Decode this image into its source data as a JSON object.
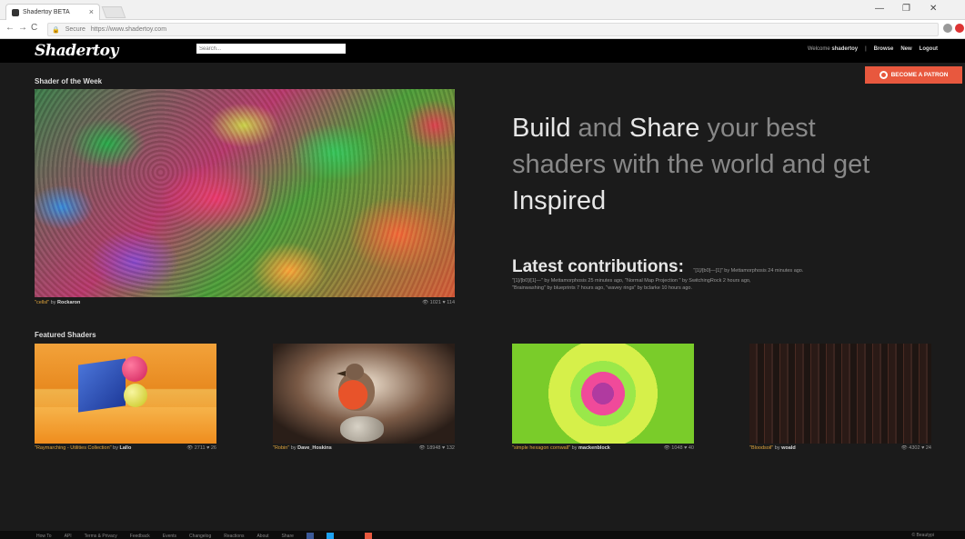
{
  "browser": {
    "tab_title": "Shadertoy BETA",
    "tab_close": "×",
    "secure_label": "Secure",
    "url": "https://www.shadertoy.com",
    "window_controls": [
      "—",
      "❐",
      "✕"
    ],
    "nav": [
      "←",
      "→",
      "C"
    ]
  },
  "header": {
    "logo": "Shadertoy",
    "search_placeholder": "Search...",
    "welcome_label": "Welcome",
    "username": "shadertoy",
    "separator": "|",
    "nav": [
      "Browse",
      "New",
      "Logout"
    ]
  },
  "patron": {
    "label": "BECOME A PATRON"
  },
  "shader_of_week": {
    "title": "Shader of the Week",
    "name": "\"cellsl\"",
    "by": " by ",
    "author": "Rockaron",
    "views": "👁 1021",
    "likes": "♥ 114"
  },
  "hero": {
    "part1": "Build",
    "part2": " and ",
    "part3": "Share",
    "part4": " your best shaders with the world and get ",
    "part5": "Inspired"
  },
  "latest": {
    "title": "Latest contributions:",
    "line1": "\"[1]/[b0]—[1]\" by Mettamorphosis 24 minutes ago.",
    "line2": "\"[1]/[b0]/[1]—\" by Mettamorphosis 25 minutes ago, \"Normal Map Projection \" by SwitchingRock 2 hours ago,",
    "line3": "\"Brainwashing\" by blueprints 7 hours ago, \"wavey rings\" by bclarke 10 hours ago."
  },
  "featured": {
    "title": "Featured Shaders",
    "items": [
      {
        "name": "\"Raymarching - Utilities Collection\"",
        "by": " by ",
        "author": "Lallo",
        "views": "👁 2711",
        "likes": "♥ 26"
      },
      {
        "name": "\"Robin\"",
        "by": " by ",
        "author": "Dave_Hoskins",
        "views": "👁 18948",
        "likes": "♥ 132"
      },
      {
        "name": "\"simple hexagon cornwall\"",
        "by": " by ",
        "author": "mackenblock",
        "views": "👁 1048",
        "likes": "♥ 40"
      },
      {
        "name": "\"Bloodsoil\"",
        "by": " by ",
        "author": "woald",
        "views": "👁 4302",
        "likes": "♥ 24"
      }
    ]
  },
  "footer": {
    "links": [
      "How To",
      "API",
      "Terms & Privacy",
      "Feedback",
      "Events",
      "Changelog",
      "Reactions",
      "About",
      "Share"
    ],
    "right": "© Beautypi"
  },
  "colors": {
    "accent": "#e0a53c",
    "patron": "#e8583e",
    "background": "#1b1b1b"
  }
}
